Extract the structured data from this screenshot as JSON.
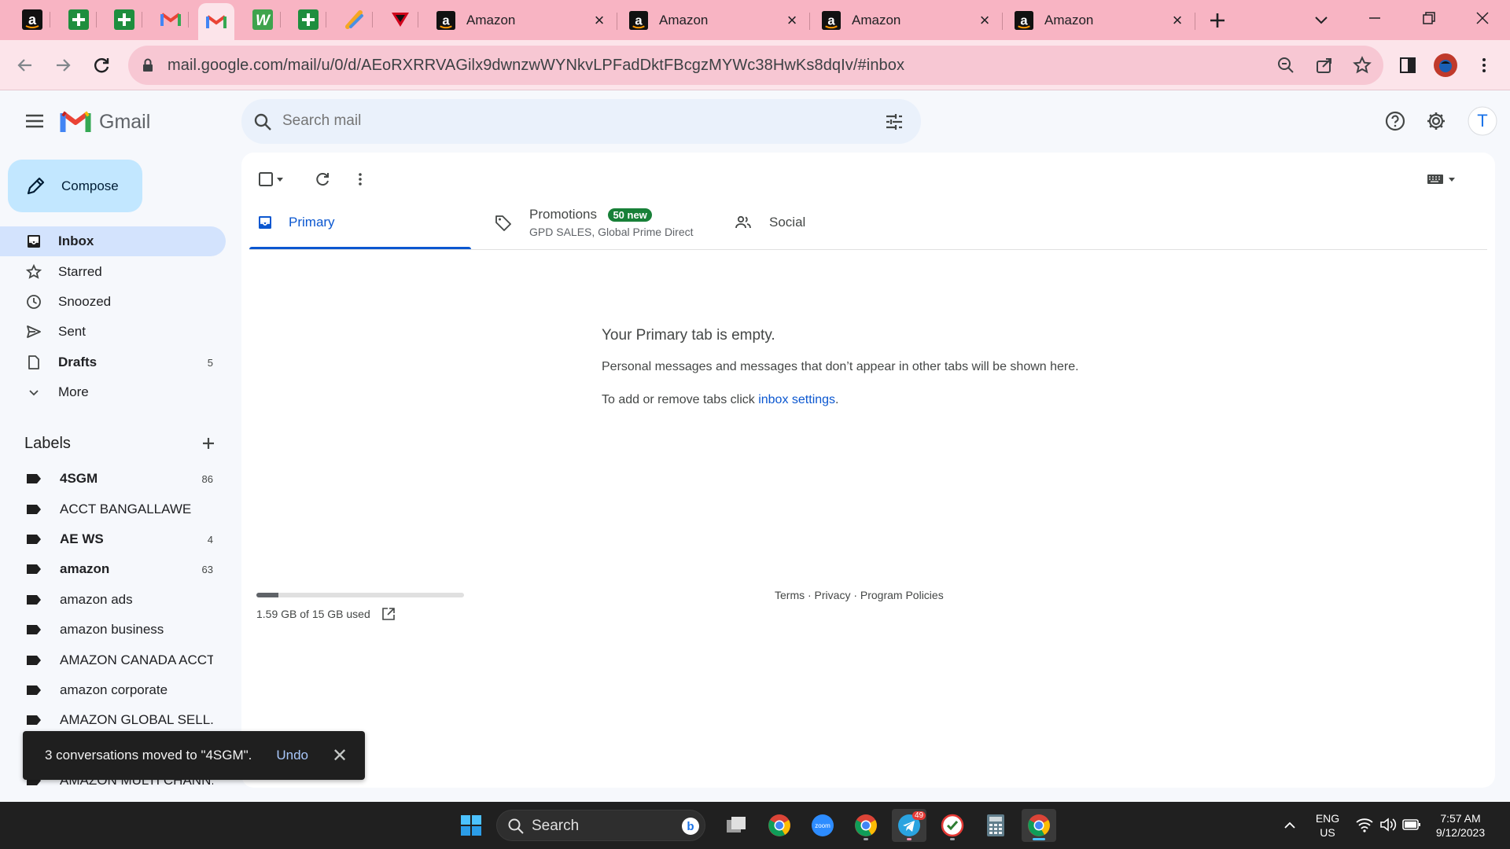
{
  "browser": {
    "tabs": [
      {
        "title": "Amazon"
      },
      {
        "title": "Amazon"
      },
      {
        "title": "Amazon"
      },
      {
        "title": "Amazon"
      }
    ],
    "url": "mail.google.com/mail/u/0/d/AEoRXRRVAGilx9dwnzwWYNkvLPFadDktFBcgzMYWc38HwKs8dqIv/#inbox"
  },
  "gmail": {
    "brand": "Gmail",
    "search_placeholder": "Search mail",
    "compose_label": "Compose",
    "avatar_initial": "T",
    "nav": [
      {
        "label": "Inbox",
        "count": "",
        "icon": "inbox-icon"
      },
      {
        "label": "Starred",
        "count": "",
        "icon": "star-icon"
      },
      {
        "label": "Snoozed",
        "count": "",
        "icon": "clock-icon"
      },
      {
        "label": "Sent",
        "count": "",
        "icon": "send-icon"
      },
      {
        "label": "Drafts",
        "count": "5",
        "icon": "draft-icon"
      },
      {
        "label": "More",
        "count": "",
        "icon": "chevron-down-icon"
      }
    ],
    "labels_title": "Labels",
    "labels": [
      {
        "label": "4SGM",
        "count": "86"
      },
      {
        "label": "ACCT BANGALLAWE",
        "count": ""
      },
      {
        "label": "AE WS",
        "count": "4"
      },
      {
        "label": "amazon",
        "count": "63"
      },
      {
        "label": "amazon ads",
        "count": ""
      },
      {
        "label": "amazon business",
        "count": ""
      },
      {
        "label": "AMAZON CANADA ACCT",
        "count": ""
      },
      {
        "label": "amazon corporate",
        "count": ""
      },
      {
        "label": "AMAZON GLOBAL SELL...",
        "count": ""
      },
      {
        "label": "AMAZON MULTI CHANN...",
        "count": ""
      }
    ],
    "category_tabs": {
      "primary": "Primary",
      "promotions": "Promotions",
      "promotions_badge": "50 new",
      "promotions_sub": "GPD SALES, Global Prime Direct",
      "social": "Social"
    },
    "empty": {
      "title": "Your Primary tab is empty.",
      "body": "Personal messages and messages that don’t appear in other tabs will be shown here.",
      "hint_prefix": "To add or remove tabs click ",
      "hint_link": "inbox settings",
      "hint_suffix": "."
    },
    "storage": {
      "text": "1.59 GB of 15 GB used",
      "used_fraction": 0.106
    },
    "footer": "Terms · Privacy · Program Policies",
    "snackbar": {
      "message": "3 conversations moved to \"4SGM\".",
      "action": "Undo"
    }
  },
  "taskbar": {
    "search_label": "Search",
    "lang": "ENG",
    "region": "US",
    "time": "7:57 AM",
    "date": "9/12/2023",
    "telegram_badge": "49"
  },
  "colors": {
    "tabstrip": "#f8b4c3",
    "toolbar": "#fce4ea",
    "accent": "#0b57d0",
    "compose": "#c2e7ff",
    "badge": "#188038"
  }
}
